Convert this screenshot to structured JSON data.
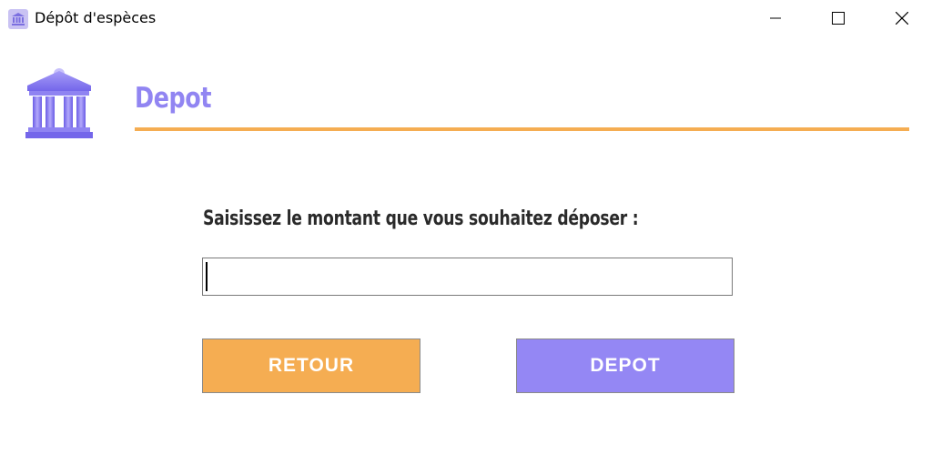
{
  "window": {
    "title": "Dépôt d'espèces",
    "controls": [
      "minimize",
      "maximize",
      "close"
    ]
  },
  "header": {
    "title": "Depot",
    "icon": "bank-building-icon"
  },
  "form": {
    "prompt": "Saisissez le montant que vous souhaitez déposer :",
    "amount_value": "",
    "amount_placeholder": ""
  },
  "buttons": {
    "back_label": "RETOUR",
    "deposit_label": "DEPOT"
  },
  "colors": {
    "accent_purple": "#9185f2",
    "accent_orange": "#f5ad52",
    "button_back": "#f5ad52",
    "button_deposit": "#9487f4"
  }
}
